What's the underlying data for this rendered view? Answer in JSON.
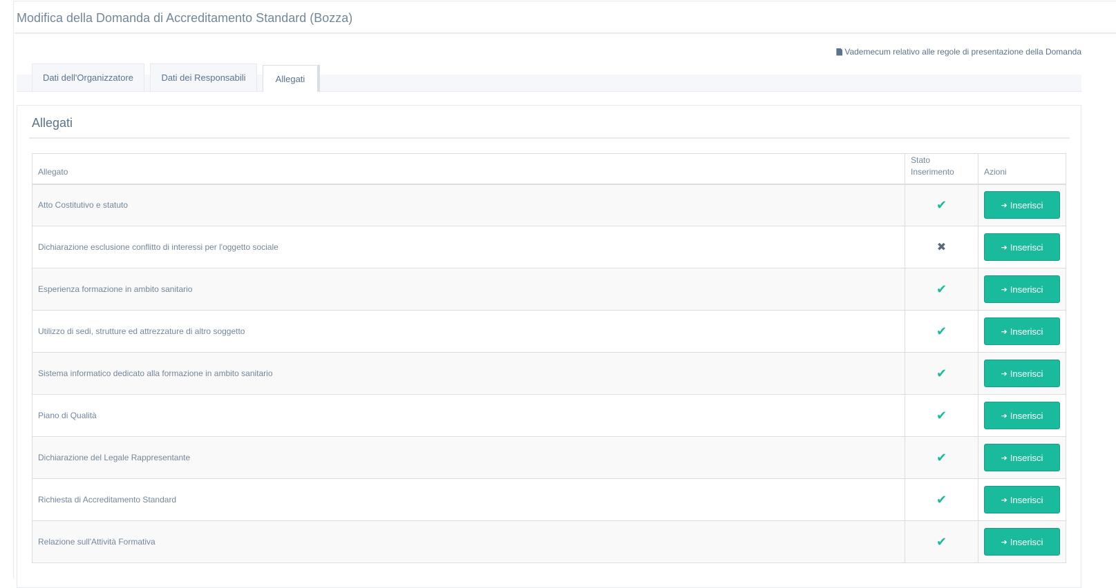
{
  "header": {
    "title": "Modifica della Domanda di Accreditamento Standard (Bozza)",
    "vademecum_link": "Vademecum relativo alle regole di presentazione della Domanda",
    "vademecum_icon": "document-icon"
  },
  "tabs": [
    {
      "label": "Dati dell'Organizzatore",
      "active": false
    },
    {
      "label": "Dati dei Responsabili",
      "active": false
    },
    {
      "label": "Allegati",
      "active": true
    }
  ],
  "panel": {
    "title": "Allegati"
  },
  "table": {
    "columns": {
      "allegato": "Allegato",
      "stato": "Stato Inserimento",
      "azioni": "Azioni"
    },
    "button_label": "Inserisci",
    "button_icon": "sign-in-icon",
    "status_symbols": {
      "ok": "✔",
      "missing": "✖"
    },
    "rows": [
      {
        "name": "Atto Costitutivo e statuto",
        "status": "ok"
      },
      {
        "name": "Dichiarazione esclusione conflitto di interessi per l'oggetto sociale",
        "status": "missing"
      },
      {
        "name": "Esperienza formazione in ambito sanitario",
        "status": "ok"
      },
      {
        "name": "Utilizzo di sedi, strutture ed attrezzature di altro soggetto",
        "status": "ok"
      },
      {
        "name": "Sistema informatico dedicato alla formazione in ambito sanitario",
        "status": "ok"
      },
      {
        "name": "Piano di Qualità",
        "status": "ok"
      },
      {
        "name": "Dichiarazione del Legale Rappresentante",
        "status": "ok"
      },
      {
        "name": "Richiesta di Accreditamento Standard",
        "status": "ok"
      },
      {
        "name": "Relazione sull'Attività Formativa",
        "status": "ok"
      }
    ]
  },
  "colors": {
    "accent": "#1abb9c",
    "text": "#73879c"
  }
}
